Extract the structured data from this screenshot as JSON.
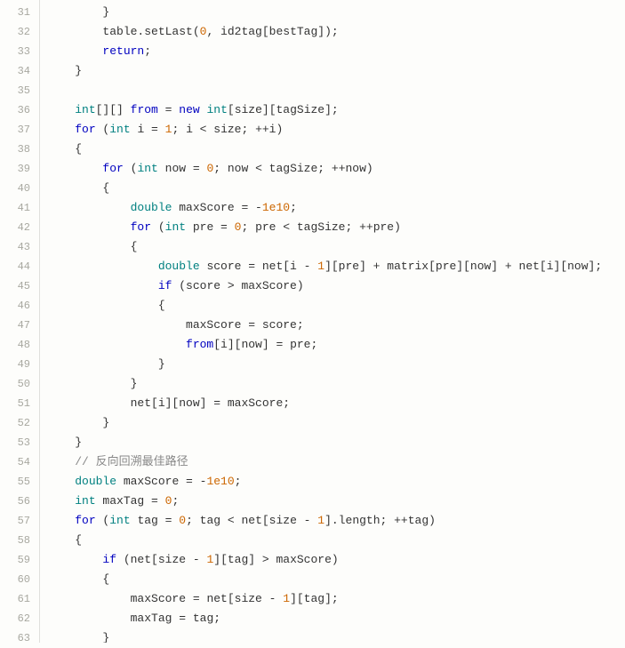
{
  "lines": [
    {
      "num": 31,
      "indent": 8,
      "tokens": [
        {
          "t": "p",
          "v": "}"
        }
      ]
    },
    {
      "num": 32,
      "indent": 8,
      "tokens": [
        {
          "t": "m",
          "v": "table.setLast("
        },
        {
          "t": "n",
          "v": "0"
        },
        {
          "t": "m",
          "v": ", id2tag[bestTag]);"
        }
      ]
    },
    {
      "num": 33,
      "indent": 8,
      "tokens": [
        {
          "t": "k",
          "v": "return"
        },
        {
          "t": "p",
          "v": ";"
        }
      ]
    },
    {
      "num": 34,
      "indent": 4,
      "tokens": [
        {
          "t": "p",
          "v": "}"
        }
      ]
    },
    {
      "num": 35,
      "indent": 0,
      "tokens": []
    },
    {
      "num": 36,
      "indent": 4,
      "tokens": [
        {
          "t": "t",
          "v": "int"
        },
        {
          "t": "p",
          "v": "[][] "
        },
        {
          "t": "k",
          "v": "from"
        },
        {
          "t": "p",
          "v": " = "
        },
        {
          "t": "k",
          "v": "new"
        },
        {
          "t": "p",
          "v": " "
        },
        {
          "t": "t",
          "v": "int"
        },
        {
          "t": "p",
          "v": "[size][tagSize];"
        }
      ]
    },
    {
      "num": 37,
      "indent": 4,
      "tokens": [
        {
          "t": "k",
          "v": "for"
        },
        {
          "t": "p",
          "v": " ("
        },
        {
          "t": "t",
          "v": "int"
        },
        {
          "t": "p",
          "v": " i = "
        },
        {
          "t": "n",
          "v": "1"
        },
        {
          "t": "p",
          "v": "; i < size; ++i)"
        }
      ]
    },
    {
      "num": 38,
      "indent": 4,
      "tokens": [
        {
          "t": "p",
          "v": "{"
        }
      ]
    },
    {
      "num": 39,
      "indent": 8,
      "tokens": [
        {
          "t": "k",
          "v": "for"
        },
        {
          "t": "p",
          "v": " ("
        },
        {
          "t": "t",
          "v": "int"
        },
        {
          "t": "p",
          "v": " now = "
        },
        {
          "t": "n",
          "v": "0"
        },
        {
          "t": "p",
          "v": "; now < tagSize; ++now)"
        }
      ]
    },
    {
      "num": 40,
      "indent": 8,
      "tokens": [
        {
          "t": "p",
          "v": "{"
        }
      ]
    },
    {
      "num": 41,
      "indent": 12,
      "tokens": [
        {
          "t": "t",
          "v": "double"
        },
        {
          "t": "p",
          "v": " maxScore = -"
        },
        {
          "t": "n",
          "v": "1e10"
        },
        {
          "t": "p",
          "v": ";"
        }
      ]
    },
    {
      "num": 42,
      "indent": 12,
      "tokens": [
        {
          "t": "k",
          "v": "for"
        },
        {
          "t": "p",
          "v": " ("
        },
        {
          "t": "t",
          "v": "int"
        },
        {
          "t": "p",
          "v": " pre = "
        },
        {
          "t": "n",
          "v": "0"
        },
        {
          "t": "p",
          "v": "; pre < tagSize; ++pre)"
        }
      ]
    },
    {
      "num": 43,
      "indent": 12,
      "tokens": [
        {
          "t": "p",
          "v": "{"
        }
      ]
    },
    {
      "num": 44,
      "indent": 16,
      "tokens": [
        {
          "t": "t",
          "v": "double"
        },
        {
          "t": "p",
          "v": " score = net[i - "
        },
        {
          "t": "n",
          "v": "1"
        },
        {
          "t": "p",
          "v": "][pre] + matrix[pre][now] + net[i][now];"
        }
      ]
    },
    {
      "num": 45,
      "indent": 16,
      "tokens": [
        {
          "t": "k",
          "v": "if"
        },
        {
          "t": "p",
          "v": " (score > maxScore)"
        }
      ]
    },
    {
      "num": 46,
      "indent": 16,
      "tokens": [
        {
          "t": "p",
          "v": "{"
        }
      ]
    },
    {
      "num": 47,
      "indent": 20,
      "tokens": [
        {
          "t": "p",
          "v": "maxScore = score;"
        }
      ]
    },
    {
      "num": 48,
      "indent": 20,
      "tokens": [
        {
          "t": "k",
          "v": "from"
        },
        {
          "t": "p",
          "v": "[i][now] = pre;"
        }
      ]
    },
    {
      "num": 49,
      "indent": 16,
      "tokens": [
        {
          "t": "p",
          "v": "}"
        }
      ]
    },
    {
      "num": 50,
      "indent": 12,
      "tokens": [
        {
          "t": "p",
          "v": "}"
        }
      ]
    },
    {
      "num": 51,
      "indent": 12,
      "tokens": [
        {
          "t": "p",
          "v": "net[i][now] = maxScore;"
        }
      ]
    },
    {
      "num": 52,
      "indent": 8,
      "tokens": [
        {
          "t": "p",
          "v": "}"
        }
      ]
    },
    {
      "num": 53,
      "indent": 4,
      "tokens": [
        {
          "t": "p",
          "v": "}"
        }
      ]
    },
    {
      "num": 54,
      "indent": 4,
      "tokens": [
        {
          "t": "c",
          "v": "// 反向回溯最佳路径"
        }
      ]
    },
    {
      "num": 55,
      "indent": 4,
      "tokens": [
        {
          "t": "t",
          "v": "double"
        },
        {
          "t": "p",
          "v": " maxScore = -"
        },
        {
          "t": "n",
          "v": "1e10"
        },
        {
          "t": "p",
          "v": ";"
        }
      ]
    },
    {
      "num": 56,
      "indent": 4,
      "tokens": [
        {
          "t": "t",
          "v": "int"
        },
        {
          "t": "p",
          "v": " maxTag = "
        },
        {
          "t": "n",
          "v": "0"
        },
        {
          "t": "p",
          "v": ";"
        }
      ]
    },
    {
      "num": 57,
      "indent": 4,
      "tokens": [
        {
          "t": "k",
          "v": "for"
        },
        {
          "t": "p",
          "v": " ("
        },
        {
          "t": "t",
          "v": "int"
        },
        {
          "t": "p",
          "v": " tag = "
        },
        {
          "t": "n",
          "v": "0"
        },
        {
          "t": "p",
          "v": "; tag < net[size - "
        },
        {
          "t": "n",
          "v": "1"
        },
        {
          "t": "p",
          "v": "].length; ++tag)"
        }
      ]
    },
    {
      "num": 58,
      "indent": 4,
      "tokens": [
        {
          "t": "p",
          "v": "{"
        }
      ]
    },
    {
      "num": 59,
      "indent": 8,
      "tokens": [
        {
          "t": "k",
          "v": "if"
        },
        {
          "t": "p",
          "v": " (net[size - "
        },
        {
          "t": "n",
          "v": "1"
        },
        {
          "t": "p",
          "v": "][tag] > maxScore)"
        }
      ]
    },
    {
      "num": 60,
      "indent": 8,
      "tokens": [
        {
          "t": "p",
          "v": "{"
        }
      ]
    },
    {
      "num": 61,
      "indent": 12,
      "tokens": [
        {
          "t": "p",
          "v": "maxScore = net[size - "
        },
        {
          "t": "n",
          "v": "1"
        },
        {
          "t": "p",
          "v": "][tag];"
        }
      ]
    },
    {
      "num": 62,
      "indent": 12,
      "tokens": [
        {
          "t": "p",
          "v": "maxTag = tag;"
        }
      ]
    },
    {
      "num": 63,
      "indent": 8,
      "tokens": [
        {
          "t": "p",
          "v": "}"
        }
      ]
    }
  ]
}
